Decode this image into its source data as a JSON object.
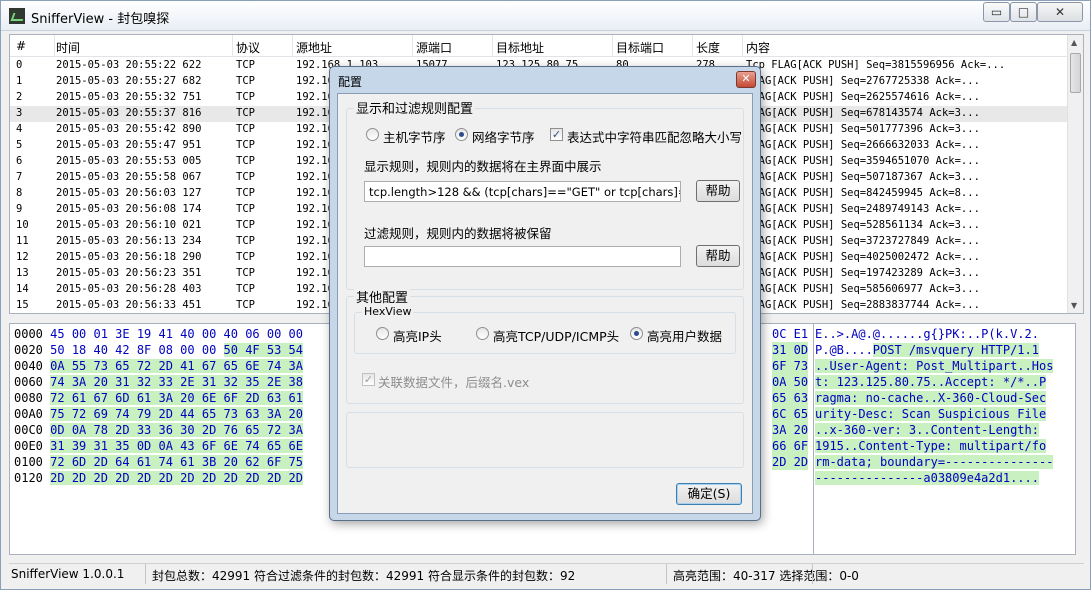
{
  "window": {
    "title": "SnifferView - 封包嗅探",
    "min_glyph": "▭",
    "max_glyph": "□",
    "close_glyph": "✕"
  },
  "packet_list": {
    "columns": [
      "#",
      "时间",
      "协议",
      "源地址",
      "源端口",
      "目标地址",
      "目标端口",
      "长度",
      "内容"
    ],
    "selected_index": 3,
    "rows": [
      [
        "0",
        "2015-05-03 20:55:22 622",
        "TCP",
        "192.168.1.103",
        "15077",
        "123.125.80.75",
        "80",
        "278",
        "Tcp FLAG[ACK PUSH] Seq=3815596956 Ack=..."
      ],
      [
        "1",
        "2015-05-03 20:55:27 682",
        "TCP",
        "192.16",
        "",
        "",
        "",
        "",
        "FLAG[ACK PUSH] Seq=2767725338 Ack=..."
      ],
      [
        "2",
        "2015-05-03 20:55:32 751",
        "TCP",
        "192.16",
        "",
        "",
        "",
        "",
        "FLAG[ACK PUSH] Seq=2625574616 Ack=..."
      ],
      [
        "3",
        "2015-05-03 20:55:37 816",
        "TCP",
        "192.16",
        "",
        "",
        "",
        "",
        "FLAG[ACK PUSH] Seq=678143574 Ack=3..."
      ],
      [
        "4",
        "2015-05-03 20:55:42 890",
        "TCP",
        "192.16",
        "",
        "",
        "",
        "",
        "FLAG[ACK PUSH] Seq=501777396 Ack=3..."
      ],
      [
        "5",
        "2015-05-03 20:55:47 951",
        "TCP",
        "192.16",
        "",
        "",
        "",
        "",
        "FLAG[ACK PUSH] Seq=2666632033 Ack=..."
      ],
      [
        "6",
        "2015-05-03 20:55:53 005",
        "TCP",
        "192.16",
        "",
        "",
        "",
        "",
        "FLAG[ACK PUSH] Seq=3594651070 Ack=..."
      ],
      [
        "7",
        "2015-05-03 20:55:58 067",
        "TCP",
        "192.16",
        "",
        "",
        "",
        "",
        "FLAG[ACK PUSH] Seq=507187367 Ack=3..."
      ],
      [
        "8",
        "2015-05-03 20:56:03 127",
        "TCP",
        "192.16",
        "",
        "",
        "",
        "",
        "FLAG[ACK PUSH] Seq=842459945 Ack=8..."
      ],
      [
        "9",
        "2015-05-03 20:56:08 174",
        "TCP",
        "192.16",
        "",
        "",
        "",
        "",
        "FLAG[ACK PUSH] Seq=2489749143 Ack=..."
      ],
      [
        "10",
        "2015-05-03 20:56:10 021",
        "TCP",
        "192.16",
        "",
        "",
        "",
        "",
        "FLAG[ACK PUSH] Seq=528561134 Ack=3..."
      ],
      [
        "11",
        "2015-05-03 20:56:13 234",
        "TCP",
        "192.16",
        "",
        "",
        "",
        "",
        "FLAG[ACK PUSH] Seq=3723727849 Ack=..."
      ],
      [
        "12",
        "2015-05-03 20:56:18 290",
        "TCP",
        "192.16",
        "",
        "",
        "",
        "",
        "FLAG[ACK PUSH] Seq=4025002472 Ack=..."
      ],
      [
        "13",
        "2015-05-03 20:56:23 351",
        "TCP",
        "192.16",
        "",
        "",
        "",
        "",
        "FLAG[ACK PUSH] Seq=197423289 Ack=3..."
      ],
      [
        "14",
        "2015-05-03 20:56:28 403",
        "TCP",
        "192.16",
        "",
        "",
        "",
        "",
        "FLAG[ACK PUSH] Seq=585606977 Ack=3..."
      ],
      [
        "15",
        "2015-05-03 20:56:33 451",
        "TCP",
        "192.16",
        "",
        "",
        "",
        "",
        "FLAG[ACK PUSH] Seq=2883837744 Ack=..."
      ]
    ]
  },
  "hex_view": {
    "lines": [
      {
        "offset": "0000",
        "plain": "45 00 01 3E 19 41 40 00 40 06 00 00",
        "hl": "",
        "tail": "0C E1"
      },
      {
        "offset": "0020",
        "plain": "50 18 40 42 8F 08 00 00 ",
        "hl": "50 4F 53 54",
        "tail": "31 0D"
      },
      {
        "offset": "0040",
        "plain": "",
        "hl": "0A 55 73 65 72 2D 41 67 65 6E 74 3A",
        "tail": "6F 73"
      },
      {
        "offset": "0060",
        "plain": "",
        "hl": "74 3A 20 31 32 33 2E 31 32 35 2E 38",
        "tail": "0A 50"
      },
      {
        "offset": "0080",
        "plain": "",
        "hl": "72 61 67 6D 61 3A 20 6E 6F 2D 63 61",
        "tail": "65 63"
      },
      {
        "offset": "00A0",
        "plain": "",
        "hl": "75 72 69 74 79 2D 44 65 73 63 3A 20",
        "tail": "6C 65"
      },
      {
        "offset": "00C0",
        "plain": "",
        "hl": "0D 0A 78 2D 33 36 30 2D 76 65 72 3A",
        "tail": "3A 20"
      },
      {
        "offset": "00E0",
        "plain": "",
        "hl": "31 39 31 35 0D 0A 43 6F 6E 74 65 6E",
        "tail": "66 6F"
      },
      {
        "offset": "0100",
        "plain": "",
        "hl": "72 6D 2D 64 61 74 61 3B 20 62 6F 75",
        "tail": "2D 2D"
      },
      {
        "offset": "0120",
        "plain": "",
        "hl": "2D 2D 2D 2D 2D 2D 2D 2D 2D 2D 2D 2D",
        "tail": ""
      }
    ],
    "ascii": [
      {
        "plain": "E..>.A@.@......g{}PK:..P(k.V.2.",
        "hl": ""
      },
      {
        "plain": "P.@B....",
        "hl": "POST /msvquery HTTP/1.1"
      },
      {
        "plain": "",
        "hl": "..User-Agent: Post_Multipart..Hos"
      },
      {
        "plain": "",
        "hl": "t: 123.125.80.75..Accept: */*..P"
      },
      {
        "plain": "",
        "hl": "ragma: no-cache..X-360-Cloud-Sec"
      },
      {
        "plain": "",
        "hl": "urity-Desc: Scan Suspicious File"
      },
      {
        "plain": "",
        "hl": "..x-360-ver: 3..Content-Length:"
      },
      {
        "plain": "",
        "hl": "1915..Content-Type: multipart/fo"
      },
      {
        "plain": "",
        "hl": "rm-data; boundary=---------------"
      },
      {
        "plain": "",
        "hl": "---------------a03809e4a2d1...."
      }
    ]
  },
  "status_bar": {
    "version": "SnifferView  1.0.0.1",
    "counts": "封包总数：42991  符合过滤条件的封包数：42991  符合显示条件的封包数：92",
    "ranges": "高亮范围：40-317  选择范围：0-0"
  },
  "dialog": {
    "title": "配置",
    "close_glyph": "✕",
    "group_display": {
      "legend": "显示和过滤规则配置",
      "radio_host_order": "主机字节序",
      "radio_network_order": "网络字节序",
      "selected_order": "network",
      "check_ignore_case": "表达式中字符串匹配忽略大小写",
      "ignore_case_checked": true,
      "display_rule_label": "显示规则，规则内的数据将在主界面中展示",
      "display_rule_value": "tcp.length>128 && (tcp[chars]==\"GET\" or tcp[chars]==\"POST\"",
      "help_label": "帮助",
      "filter_rule_label": "过滤规则，规则内的数据将被保留",
      "filter_rule_value": "",
      "help_label_2": "帮助"
    },
    "group_other": {
      "legend": "其他配置",
      "hexview_legend": "HexView",
      "radio_ip": "高亮IP头",
      "radio_tcp": "高亮TCP/UDP/ICMP头",
      "radio_user": "高亮用户数据",
      "selected_highlight": "user",
      "check_associate": "关联数据文件，后缀名.vex",
      "associate_checked": true
    },
    "ok_label": "确定(S)"
  }
}
